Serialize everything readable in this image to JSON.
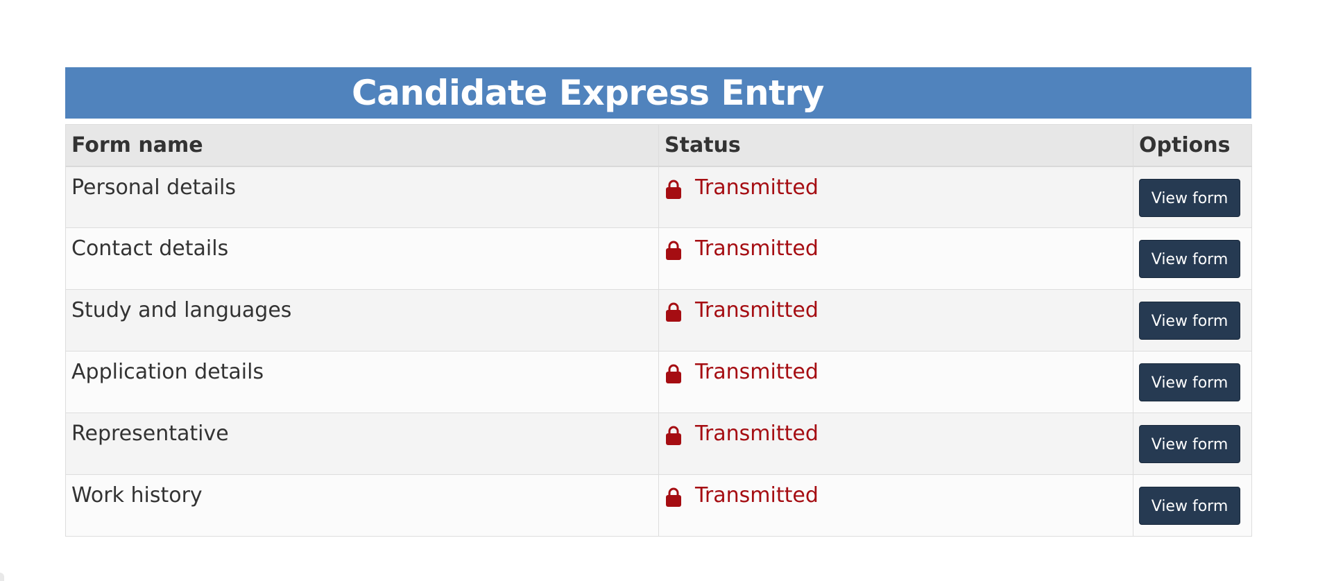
{
  "page": {
    "title": "Candidate Express Entry"
  },
  "table": {
    "headers": {
      "form_name": "Form name",
      "status": "Status",
      "options": "Options"
    },
    "rows": [
      {
        "form_name": "Personal details",
        "status": "Transmitted",
        "action": "View form"
      },
      {
        "form_name": "Contact details",
        "status": "Transmitted",
        "action": "View form"
      },
      {
        "form_name": "Study and languages",
        "status": "Transmitted",
        "action": "View form"
      },
      {
        "form_name": "Application details",
        "status": "Transmitted",
        "action": "View form"
      },
      {
        "form_name": "Representative",
        "status": "Transmitted",
        "action": "View form"
      },
      {
        "form_name": "Work history",
        "status": "Transmitted",
        "action": "View form"
      }
    ]
  },
  "icons": {
    "status": "lock-icon"
  },
  "colors": {
    "title_bar": "#5083bd",
    "status_text": "#a50d12",
    "button": "#263a52"
  }
}
